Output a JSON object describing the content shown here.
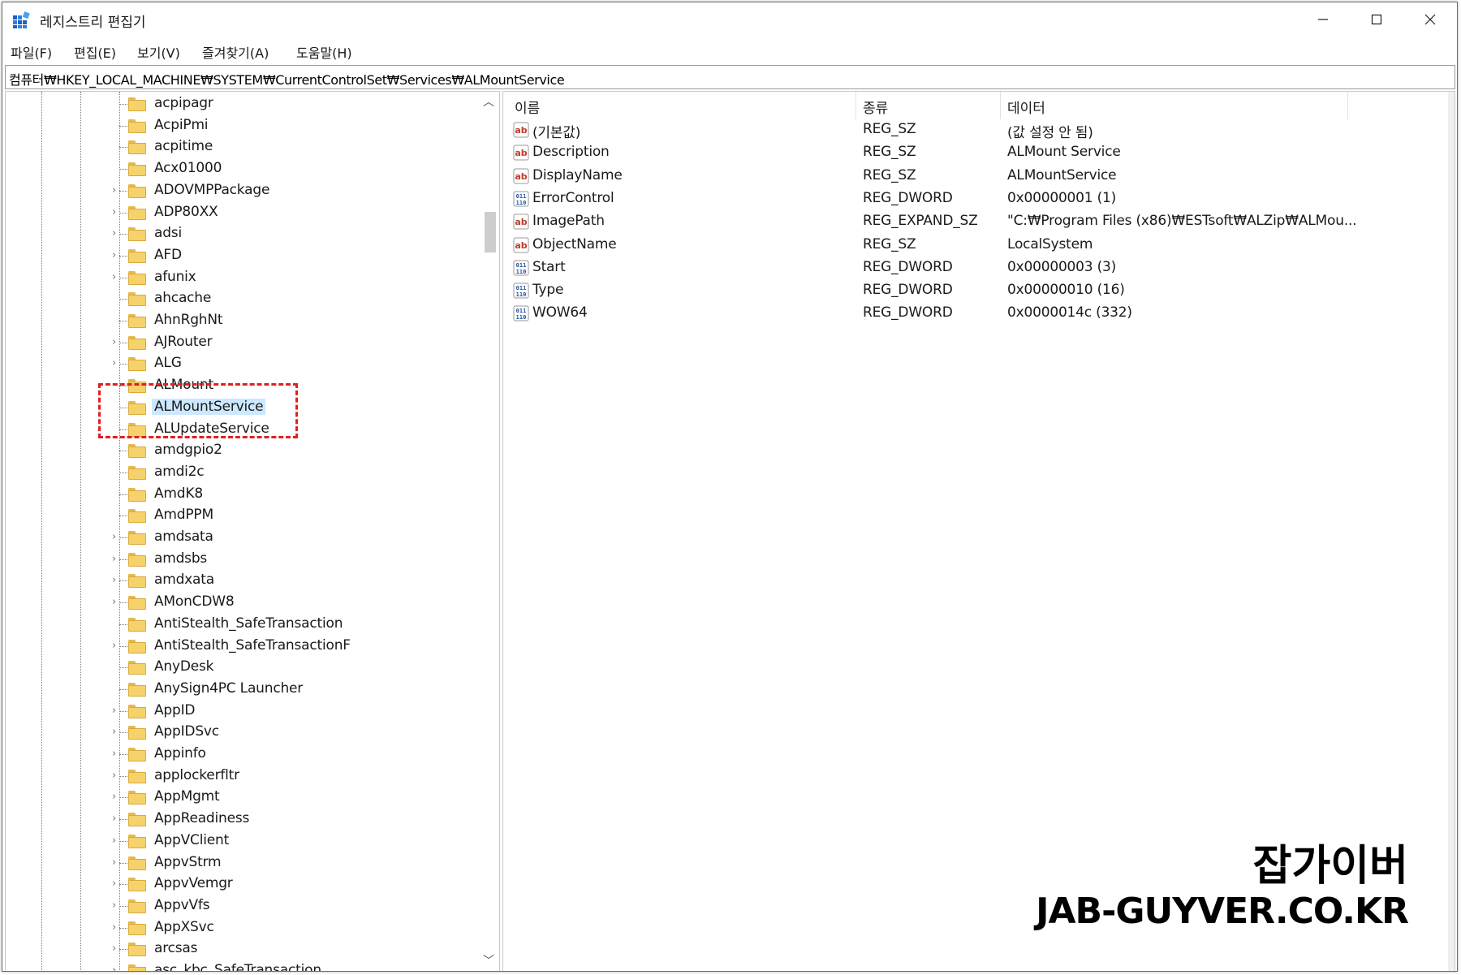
{
  "window": {
    "title": "레지스트리 편집기",
    "app_icon": "registry-editor-icon",
    "controls": {
      "minimize": "minimize-icon",
      "maximize": "maximize-icon",
      "close": "close-icon"
    }
  },
  "menu": [
    {
      "label": "파일(F)"
    },
    {
      "label": "편집(E)"
    },
    {
      "label": "보기(V)"
    },
    {
      "label": "즐겨찾기(A)"
    },
    {
      "label": "도움말(H)"
    }
  ],
  "address": {
    "path": "컴퓨터₩HKEY_LOCAL_MACHINE₩SYSTEM₩CurrentControlSet₩Services₩ALMountService"
  },
  "tree": {
    "selected": "ALMountService",
    "items": [
      {
        "label": "acpipagr",
        "expandable": false
      },
      {
        "label": "AcpiPmi",
        "expandable": false
      },
      {
        "label": "acpitime",
        "expandable": false
      },
      {
        "label": "Acx01000",
        "expandable": false
      },
      {
        "label": "ADOVMPPackage",
        "expandable": true
      },
      {
        "label": "ADP80XX",
        "expandable": true
      },
      {
        "label": "adsi",
        "expandable": true
      },
      {
        "label": "AFD",
        "expandable": true
      },
      {
        "label": "afunix",
        "expandable": true
      },
      {
        "label": "ahcache",
        "expandable": false
      },
      {
        "label": "AhnRghNt",
        "expandable": false
      },
      {
        "label": "AJRouter",
        "expandable": true
      },
      {
        "label": "ALG",
        "expandable": true
      },
      {
        "label": "ALMount",
        "expandable": false
      },
      {
        "label": "ALMountService",
        "expandable": false
      },
      {
        "label": "ALUpdateService",
        "expandable": false
      },
      {
        "label": "amdgpio2",
        "expandable": false
      },
      {
        "label": "amdi2c",
        "expandable": false
      },
      {
        "label": "AmdK8",
        "expandable": false
      },
      {
        "label": "AmdPPM",
        "expandable": false
      },
      {
        "label": "amdsata",
        "expandable": true
      },
      {
        "label": "amdsbs",
        "expandable": true
      },
      {
        "label": "amdxata",
        "expandable": true
      },
      {
        "label": "AMonCDW8",
        "expandable": true
      },
      {
        "label": "AntiStealth_SafeTransaction",
        "expandable": false
      },
      {
        "label": "AntiStealth_SafeTransactionF",
        "expandable": true
      },
      {
        "label": "AnyDesk",
        "expandable": false
      },
      {
        "label": "AnySign4PC Launcher",
        "expandable": false
      },
      {
        "label": "AppID",
        "expandable": true
      },
      {
        "label": "AppIDSvc",
        "expandable": true
      },
      {
        "label": "Appinfo",
        "expandable": true
      },
      {
        "label": "applockerfltr",
        "expandable": true
      },
      {
        "label": "AppMgmt",
        "expandable": true
      },
      {
        "label": "AppReadiness",
        "expandable": true
      },
      {
        "label": "AppVClient",
        "expandable": true
      },
      {
        "label": "AppvStrm",
        "expandable": true
      },
      {
        "label": "AppvVemgr",
        "expandable": true
      },
      {
        "label": "AppvVfs",
        "expandable": true
      },
      {
        "label": "AppXSvc",
        "expandable": true
      },
      {
        "label": "arcsas",
        "expandable": true
      },
      {
        "label": "asc_kbc_SafeTransaction",
        "expandable": true
      }
    ]
  },
  "list": {
    "columns": {
      "name": "이름",
      "type": "종류",
      "data": "데이터"
    },
    "rows": [
      {
        "icon": "string-value-icon",
        "name": "(기본값)",
        "type": "REG_SZ",
        "data": "(값 설정 안 됨)"
      },
      {
        "icon": "string-value-icon",
        "name": "Description",
        "type": "REG_SZ",
        "data": "ALMount Service"
      },
      {
        "icon": "string-value-icon",
        "name": "DisplayName",
        "type": "REG_SZ",
        "data": "ALMountService"
      },
      {
        "icon": "binary-value-icon",
        "name": "ErrorControl",
        "type": "REG_DWORD",
        "data": "0x00000001 (1)"
      },
      {
        "icon": "string-value-icon",
        "name": "ImagePath",
        "type": "REG_EXPAND_SZ",
        "data": "\"C:₩Program Files (x86)₩ESTsoft₩ALZip₩ALMou..."
      },
      {
        "icon": "string-value-icon",
        "name": "ObjectName",
        "type": "REG_SZ",
        "data": "LocalSystem"
      },
      {
        "icon": "binary-value-icon",
        "name": "Start",
        "type": "REG_DWORD",
        "data": "0x00000003 (3)"
      },
      {
        "icon": "binary-value-icon",
        "name": "Type",
        "type": "REG_DWORD",
        "data": "0x00000010 (16)"
      },
      {
        "icon": "binary-value-icon",
        "name": "WOW64",
        "type": "REG_DWORD",
        "data": "0x0000014c (332)"
      }
    ]
  },
  "watermark": {
    "name": "잡가이버",
    "url": "JAB-GUYVER.CO.KR"
  },
  "colors": {
    "selection": "#cce8ff",
    "folder": "#f6d26b",
    "highlight_box": "#e02020"
  }
}
